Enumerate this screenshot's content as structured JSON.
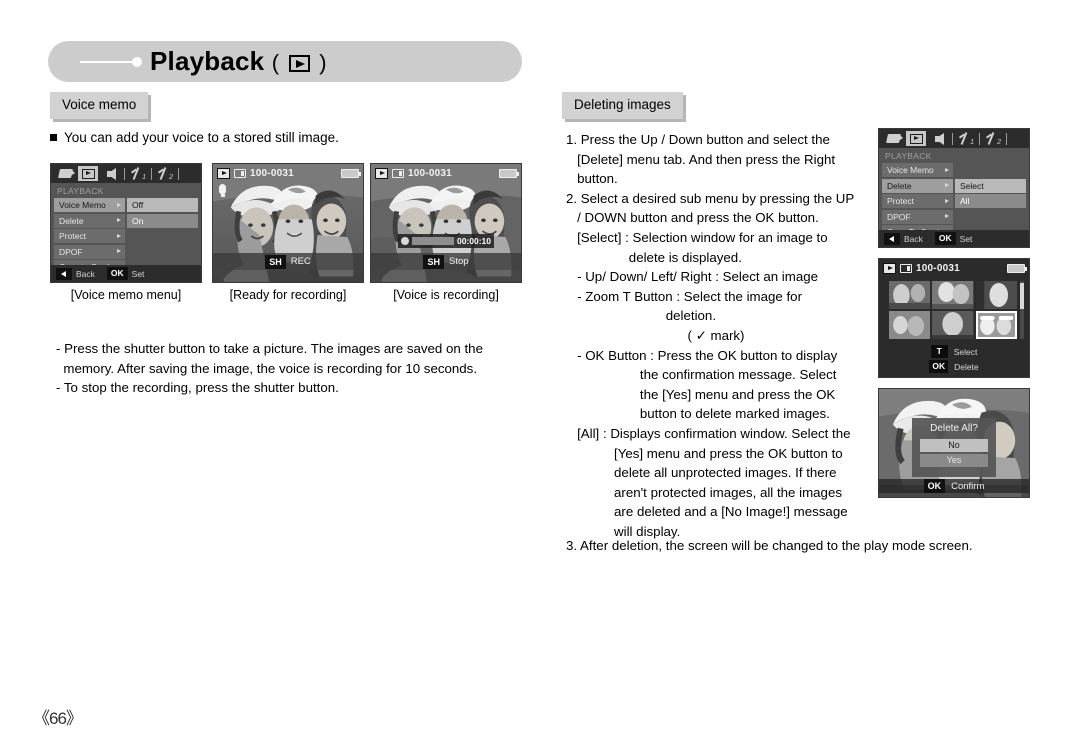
{
  "header": {
    "title": "Playback",
    "paren_open": "(",
    "paren_close": ")",
    "icon": "play-icon"
  },
  "sections": {
    "voice_memo_tab": "Voice memo",
    "deleting_images_tab": "Deleting images"
  },
  "left": {
    "bullet": "You can add your voice to a stored still image.",
    "notes": [
      "- Press the shutter button to take a picture. The images are saved on the",
      "  memory. After saving the image, the voice is recording for 10 seconds.",
      "- To stop the recording, press the shutter button."
    ],
    "captions": [
      "[Voice memo menu]",
      "[Ready for recording]",
      "[Voice is recording]"
    ]
  },
  "right": {
    "lines": [
      "1. Press the Up / Down button and select the",
      "   [Delete] menu tab. And then press the Right",
      "   button.",
      "2. Select a desired sub menu by pressing the UP",
      "   / DOWN button and press the OK button.",
      "   [Select] : Selection window for an image to",
      "                 delete is displayed.",
      "   - Up/ Down/ Left/ Right : Select an image",
      "   - Zoom T Button : Select the image for",
      "                           deletion."
    ],
    "mark_line_prefix": "(",
    "mark_line_glyph": "✓",
    "mark_line_suffix": " mark)",
    "lines2": [
      "   - OK Button : Press the OK button to display",
      "                    the confirmation message. Select",
      "                    the [Yes] menu and press the OK",
      "                    button to delete marked images.",
      "   [All] : Displays confirmation window. Select the",
      "             [Yes] menu and press the OK button to",
      "             delete all unprotected images. If there",
      "             aren't protected images, all the images",
      "             are deleted and a [No Image!] message",
      "             will display."
    ],
    "final_line": "3. After deletion, the screen will be changed to the play mode screen."
  },
  "lcd_voice_menu": {
    "menu_title": "PLAYBACK",
    "items": [
      {
        "label": "Voice Memo",
        "highlight": true
      },
      {
        "label": "Delete",
        "highlight": false
      },
      {
        "label": "Protect",
        "highlight": false
      },
      {
        "label": "DPOF",
        "highlight": false
      },
      {
        "label": "Copy to Card",
        "highlight": false
      }
    ],
    "sub_items": [
      {
        "label": "Off",
        "state": "selected"
      },
      {
        "label": "On",
        "state": "on"
      }
    ],
    "back_label": "Back",
    "ok_key": "OK",
    "set_label": "Set"
  },
  "lcd_delete_menu": {
    "menu_title": "PLAYBACK",
    "items": [
      {
        "label": "Voice Memo",
        "highlight": false
      },
      {
        "label": "Delete",
        "highlight": true
      },
      {
        "label": "Protect",
        "highlight": false
      },
      {
        "label": "DPOF",
        "highlight": false
      },
      {
        "label": "Copy To Card",
        "highlight": false
      }
    ],
    "sub_items": [
      {
        "label": "Select",
        "state": "selected"
      },
      {
        "label": "All",
        "state": "on"
      }
    ],
    "back_label": "Back",
    "ok_key": "OK",
    "set_label": "Set"
  },
  "lcd_ready": {
    "file_no": "100-0031",
    "sh_key": "SH",
    "status": "REC"
  },
  "lcd_recording": {
    "file_no": "100-0031",
    "time": "00:00:10",
    "sh_key": "SH",
    "status": "Stop"
  },
  "lcd_thumbs": {
    "file_no": "100-0031",
    "legend": [
      {
        "key": "T",
        "text": "Select"
      },
      {
        "key": "OK",
        "text": "Delete"
      }
    ]
  },
  "lcd_confirm": {
    "dialog_title": "Delete All?",
    "options": [
      {
        "label": "No",
        "selected": true
      },
      {
        "label": "Yes",
        "selected": false
      }
    ],
    "ok_key": "OK",
    "confirm_label": "Confirm"
  },
  "footer": {
    "page_number": "《66》"
  },
  "colors": {
    "banner_bg": "#cccccc",
    "tab_bg": "#d2d2d2",
    "lcd_menu_bg": "#555555",
    "lcd_bar_bg": "#2c2c2c"
  }
}
